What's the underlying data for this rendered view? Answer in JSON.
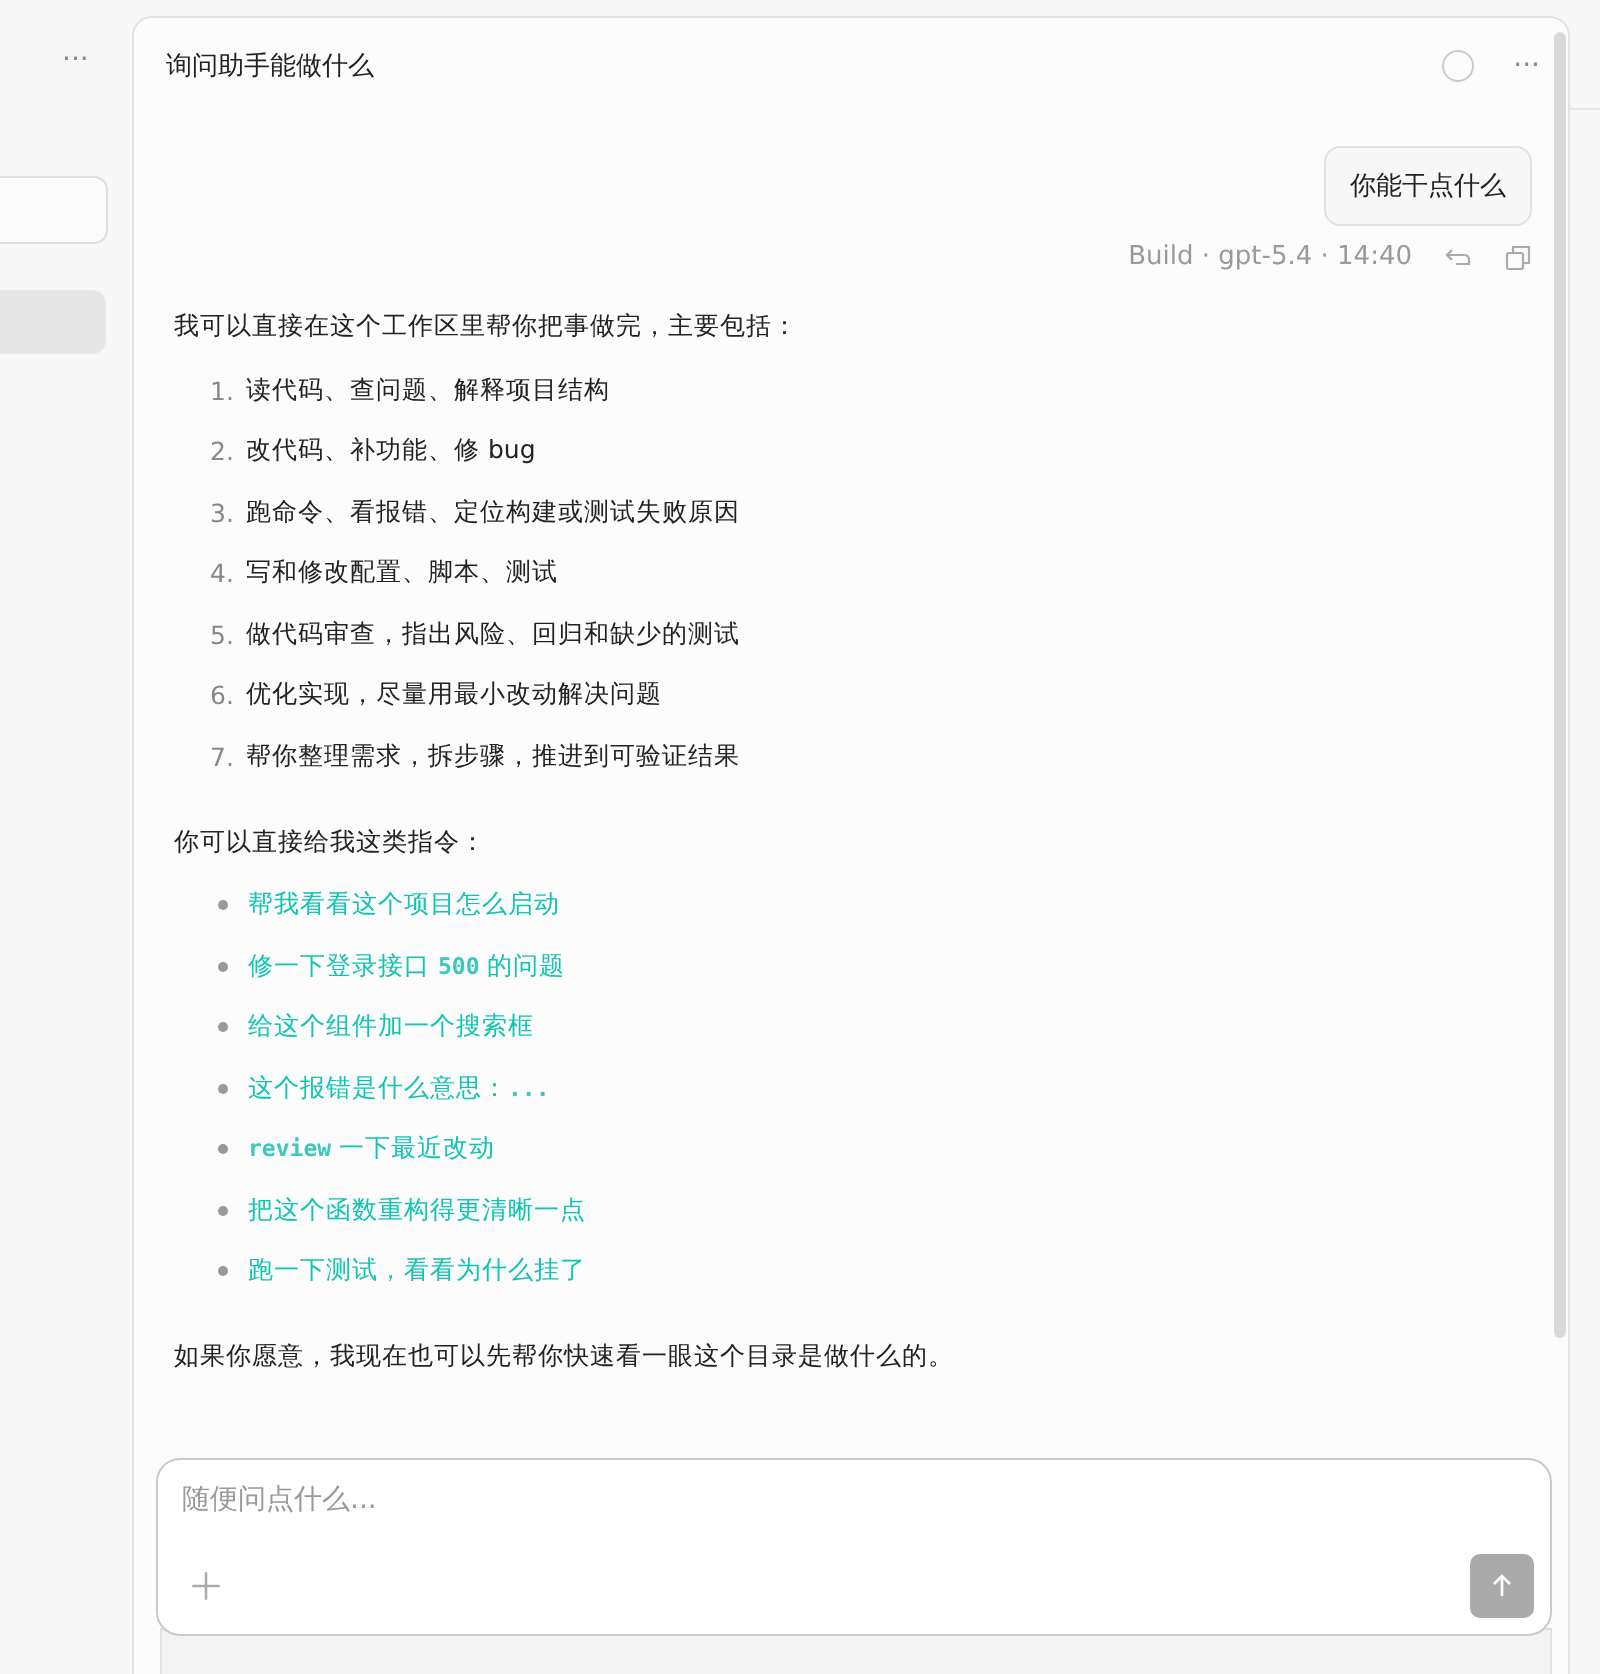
{
  "sidebar": {
    "more": "···"
  },
  "conversation": {
    "title": "询问助手能做什么",
    "more": "···"
  },
  "user_message": {
    "text": "你能干点什么",
    "meta": "Build · gpt-5.4 · 14:40"
  },
  "reply": {
    "intro": "我可以直接在这个工作区里帮你把事做完，主要包括：",
    "numbered": [
      {
        "num": "1.",
        "text": "读代码、查问题、解释项目结构"
      },
      {
        "num": "2.",
        "text": "改代码、补功能、修 bug"
      },
      {
        "num": "3.",
        "text": "跑命令、看报错、定位构建或测试失败原因"
      },
      {
        "num": "4.",
        "text": "写和修改配置、脚本、测试"
      },
      {
        "num": "5.",
        "text": "做代码审查，指出风险、回归和缺少的测试"
      },
      {
        "num": "6.",
        "text": "优化实现，尽量用最小改动解决问题"
      },
      {
        "num": "7.",
        "text": "帮你整理需求，拆步骤，推进到可验证结果"
      }
    ],
    "examples_intro": "你可以直接给我这类指令：",
    "examples": [
      [
        {
          "kind": "text",
          "text": "帮我看看这个项目怎么启动"
        }
      ],
      [
        {
          "kind": "text",
          "text": "修一下登录接口 "
        },
        {
          "kind": "code",
          "text": "500"
        },
        {
          "kind": "text",
          "text": " 的问题"
        }
      ],
      [
        {
          "kind": "text",
          "text": "给这个组件加一个搜索框"
        }
      ],
      [
        {
          "kind": "text",
          "text": "这个报错是什么意思："
        },
        {
          "kind": "code",
          "text": "..."
        }
      ],
      [
        {
          "kind": "code",
          "text": "review"
        },
        {
          "kind": "text",
          "text": " 一下最近改动"
        }
      ],
      [
        {
          "kind": "text",
          "text": "把这个函数重构得更清晰一点"
        }
      ],
      [
        {
          "kind": "text",
          "text": "跑一下测试，看看为什么挂了"
        }
      ]
    ],
    "outro": "如果你愿意，我现在也可以先帮你快速看一眼这个目录是做什么的。"
  },
  "composer": {
    "placeholder": "随便问点什么..."
  }
}
